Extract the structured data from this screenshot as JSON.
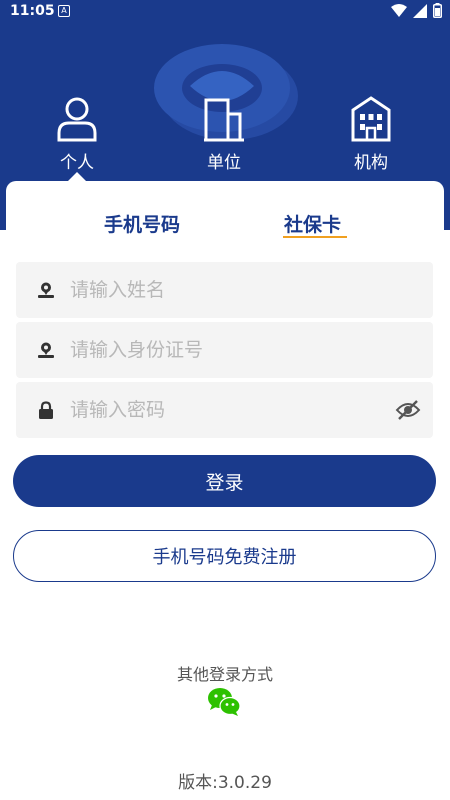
{
  "status_bar": {
    "time": "11:05",
    "notification_glyph": "A",
    "icons": [
      "wifi-icon",
      "signal-icon",
      "battery-icon"
    ]
  },
  "user_type_tabs": [
    {
      "label": "个人",
      "icon": "person-icon",
      "selected": true
    },
    {
      "label": "单位",
      "icon": "building-icon",
      "selected": false
    },
    {
      "label": "机构",
      "icon": "institution-icon",
      "selected": false
    }
  ],
  "login_method_tabs": [
    {
      "label": "手机号码",
      "selected": false
    },
    {
      "label": "社保卡",
      "selected": true
    }
  ],
  "form": {
    "name_placeholder": "请输入姓名",
    "idcard_placeholder": "请输入身份证号",
    "password_placeholder": "请输入密码"
  },
  "login_button": "登录",
  "register_button": "手机号码免费注册",
  "other_login_label": "其他登录方式",
  "version_text": "版本:3.0.29",
  "colors": {
    "primary": "#1a3a8c",
    "accent": "#f0a020",
    "field_bg": "#f4f4f4",
    "wechat": "#2dc100"
  }
}
